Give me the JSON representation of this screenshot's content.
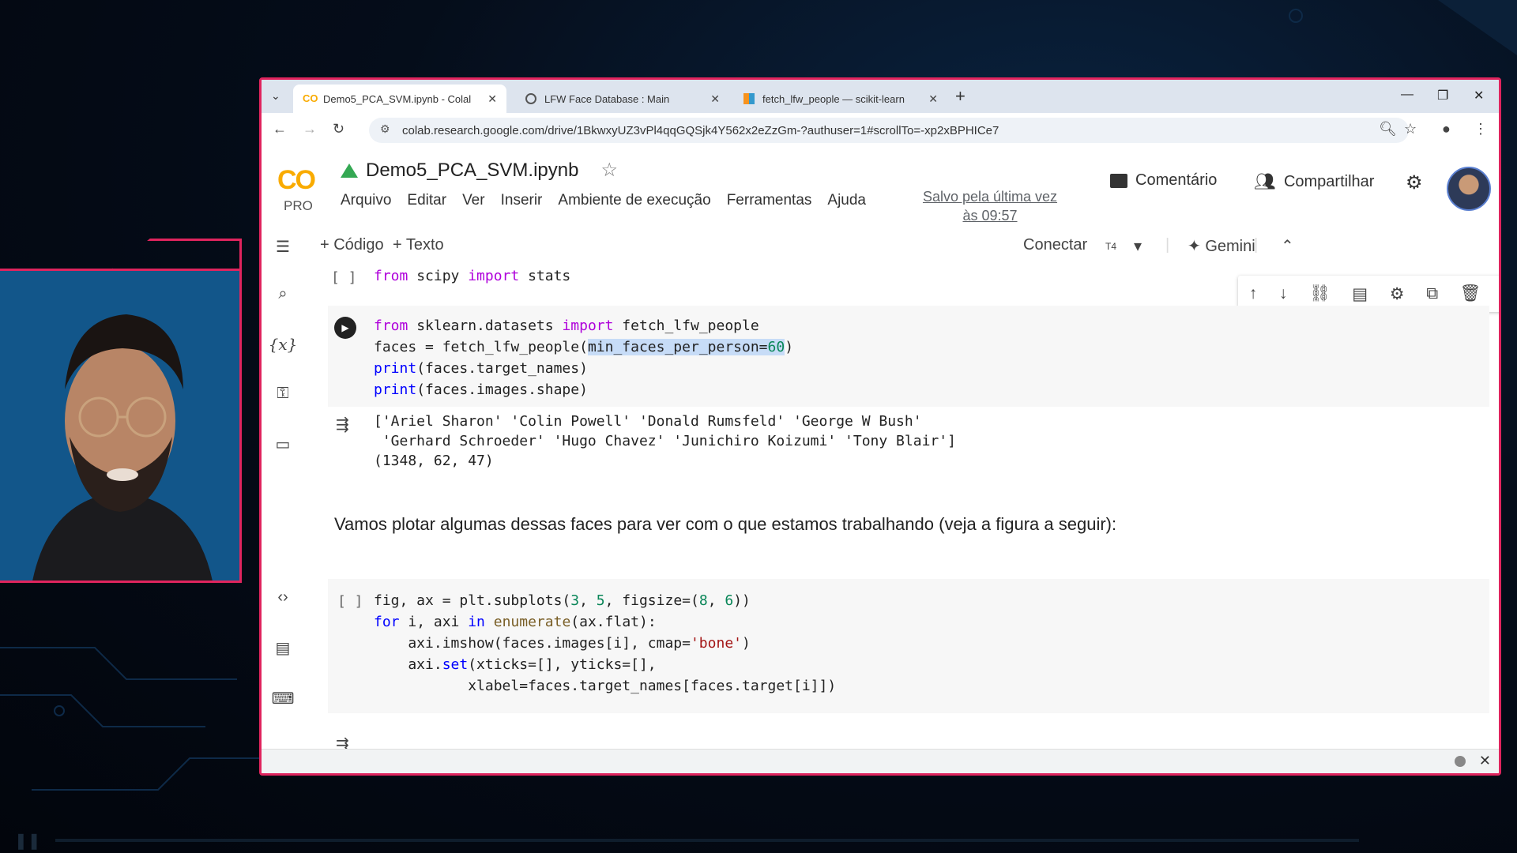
{
  "tabs": [
    {
      "label": "Demo5_PCA_SVM.ipynb - Colal",
      "active": true
    },
    {
      "label": "LFW Face Database : Main",
      "active": false
    },
    {
      "label": "fetch_lfw_people — scikit-learn",
      "active": false
    }
  ],
  "address": {
    "url": "colab.research.google.com/drive/1BkwxyUZ3vPl4qqGQSjk4Y562x2eZzGm-?authuser=1#scrollTo=-xp2xBPHICe7"
  },
  "colab": {
    "logo": "CO",
    "tier": "PRO",
    "title": "Demo5_PCA_SVM.ipynb",
    "menu": [
      "Arquivo",
      "Editar",
      "Ver",
      "Inserir",
      "Ambiente de execução",
      "Ferramentas",
      "Ajuda"
    ],
    "saved_line1": "Salvo pela última vez",
    "saved_line2": "às 09:57",
    "comment_label": "Comentário",
    "share_label": "Compartilhar"
  },
  "toolbar": {
    "add_code": "+ Código",
    "add_text": "+ Texto",
    "connect": "Conectar",
    "runtime": "T4",
    "gemini": "Gemini"
  },
  "cells": {
    "cell0_bracket": "[ ]",
    "cell0_code": "from scipy import stats",
    "cell1_out_line1": "['Ariel Sharon' 'Colin Powell' 'Donald Rumsfeld' 'George W Bush'",
    "cell1_out_line2": " 'Gerhard Schroeder' 'Hugo Chavez' 'Junichiro Koizumi' 'Tony Blair']",
    "cell1_out_line3": "(1348, 62, 47)",
    "markdown": "Vamos plotar algumas dessas faces para ver com o que estamos trabalhando (veja a figura a seguir):",
    "cell2_bracket": "[ ]"
  },
  "colors": {
    "accent_frame": "#e0245e",
    "colab_orange": "#f9ab00",
    "selection": "#c7dcf7"
  }
}
